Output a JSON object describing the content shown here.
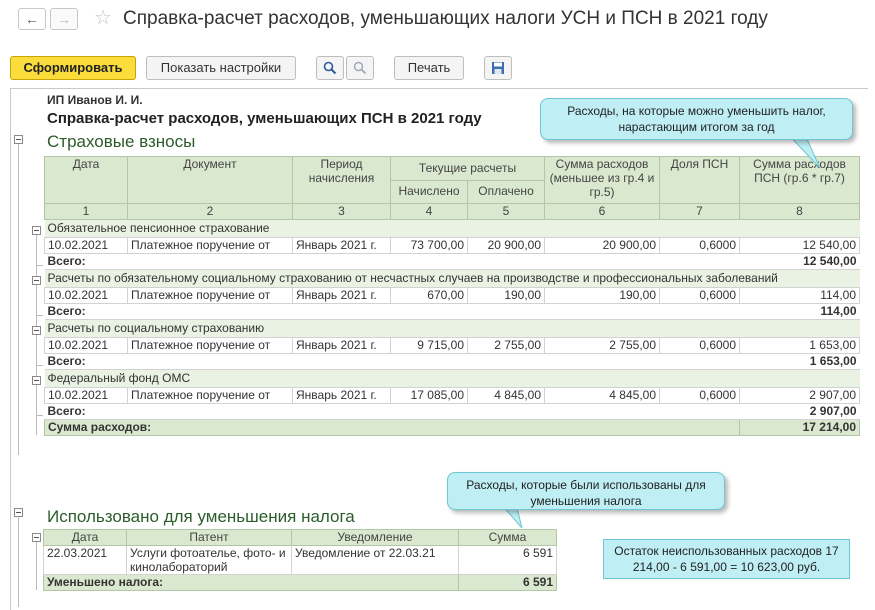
{
  "window": {
    "title": "Справка-расчет расходов, уменьшающих налоги УСН и ПСН в 2021 году"
  },
  "toolbar": {
    "generate_label": "Сформировать",
    "show_settings_label": "Показать настройки",
    "print_label": "Печать"
  },
  "report": {
    "org": "ИП Иванов И. И.",
    "title": "Справка-расчет расходов, уменьшающих ПСН в 2021 году",
    "section1": "Страховые взносы",
    "headers": {
      "date": "Дата",
      "document": "Документ",
      "period": "Период начисления",
      "current": "Текущие расчеты",
      "accrued": "Начислено",
      "paid": "Оплачено",
      "expense_sum": "Сумма расходов (меньшее из гр.4 и гр.5)",
      "psn_share": "Доля ПСН",
      "psn_expense": "Сумма расходов ПСН (гр.6 * гр.7)"
    },
    "col_numbers": [
      "1",
      "2",
      "3",
      "4",
      "5",
      "6",
      "7",
      "8"
    ],
    "groups": [
      {
        "name": "Обязательное пенсионное страхование",
        "row": [
          "10.02.2021",
          "Платежное поручение от",
          "Январь 2021 г.",
          "73 700,00",
          "20 900,00",
          "20 900,00",
          "0,6000",
          "12 540,00"
        ],
        "total_label": "Всего:",
        "total": "12 540,00"
      },
      {
        "name": "Расчеты по обязательному социальному страхованию от несчастных случаев на производстве и профессиональных заболеваний",
        "row": [
          "10.02.2021",
          "Платежное поручение от",
          "Январь 2021 г.",
          "670,00",
          "190,00",
          "190,00",
          "0,6000",
          "114,00"
        ],
        "total_label": "Всего:",
        "total": "114,00"
      },
      {
        "name": "Расчеты по социальному страхованию",
        "row": [
          "10.02.2021",
          "Платежное поручение от",
          "Январь 2021 г.",
          "9 715,00",
          "2 755,00",
          "2 755,00",
          "0,6000",
          "1 653,00"
        ],
        "total_label": "Всего:",
        "total": "1 653,00"
      },
      {
        "name": "Федеральный фонд ОМС",
        "row": [
          "10.02.2021",
          "Платежное поручение от",
          "Январь 2021 г.",
          "17 085,00",
          "4 845,00",
          "4 845,00",
          "0,6000",
          "2 907,00"
        ],
        "total_label": "Всего:",
        "total": "2 907,00"
      }
    ],
    "sum_label": "Сумма расходов:",
    "sum_value": "17 214,00",
    "section2": "Использовано для уменьшения налога",
    "used_headers": [
      "Дата",
      "Патент",
      "Уведомление",
      "Сумма"
    ],
    "used_row": {
      "date": "22.03.2021",
      "patent": "Услуги фотоателье, фото- и кинолабораторий",
      "notice": "Уведомление от 22.03.21",
      "sum": "6 591"
    },
    "reduced_label": "Уменьшено налога:",
    "reduced_value": "6 591"
  },
  "callouts": {
    "c1": "Расходы, на которые можно уменьшить налог, нарастающим итогом за год",
    "c2": "Расходы, которые были использованы для уменьшения налога",
    "c3": "Остаток неиспользованных расходов 17 214,00 - 6 591,00 = 10 623,00 руб."
  },
  "icons": [
    "arrow-left-icon",
    "arrow-right-icon",
    "star-icon",
    "search-icon",
    "search-cancel-icon",
    "save-icon",
    "collapse-icon"
  ]
}
